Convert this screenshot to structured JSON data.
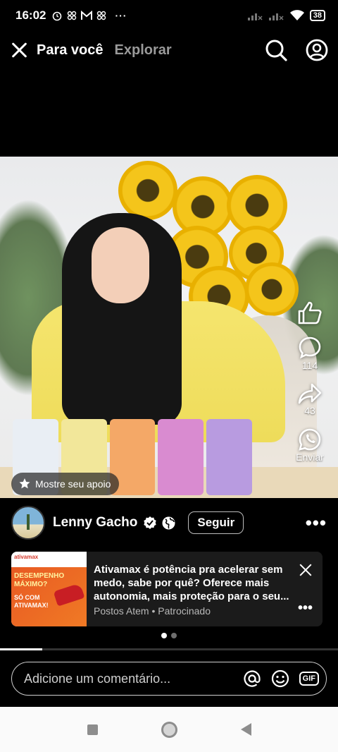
{
  "status_bar": {
    "time": "16:02",
    "left_icons": [
      "alarm-icon",
      "app-icon",
      "gmail-icon",
      "app-icon",
      "more-icon"
    ],
    "battery": "38",
    "right_icons": [
      "signal-icon",
      "signal-icon",
      "wifi-icon",
      "battery-icon"
    ]
  },
  "top_nav": {
    "tabs": [
      {
        "label": "Para você",
        "active": true
      },
      {
        "label": "Explorar",
        "active": false
      }
    ],
    "icons": [
      "close-icon",
      "search-icon",
      "profile-icon"
    ]
  },
  "video": {
    "support_pill": "Mostre seu apoio",
    "actions": [
      {
        "name": "like",
        "icon": "thumbs-up-icon",
        "count": ""
      },
      {
        "name": "comment",
        "icon": "comment-icon",
        "count": "114"
      },
      {
        "name": "share",
        "icon": "share-icon",
        "count": "43"
      },
      {
        "name": "send",
        "icon": "whatsapp-icon",
        "label": "Enviar"
      }
    ]
  },
  "author": {
    "name": "Lenny Gacho",
    "follow_label": "Seguir",
    "icons": [
      "verified-badge-icon",
      "globe-icon",
      "more-icon"
    ]
  },
  "ad": {
    "thumb": {
      "brand": "ativamax",
      "headline": "DESEMPENHO MÁXIMO?",
      "tagline": "SÓ COM ATIVAMAX!"
    },
    "title": "Ativamax é potência pra acelerar sem medo, sabe por quê? Oferece mais autonomia, mais proteção para o seu...",
    "advertiser": "Postos Atem",
    "sponsored": "Patrocinado"
  },
  "pager": {
    "count": 2,
    "active": 0
  },
  "playback": {
    "progress": 0.125
  },
  "comment": {
    "placeholder": "Adicione um comentário...",
    "gif_label": "GIF"
  },
  "colors": {
    "background": "#000000",
    "accent": "#ffffff",
    "muted": "#9a9a9a"
  }
}
